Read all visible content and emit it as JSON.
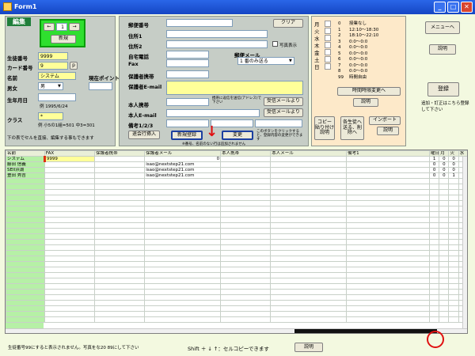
{
  "window": {
    "title": "Form1",
    "minimize": "_",
    "maximize": "□",
    "close": "✕"
  },
  "edit": {
    "badge": "編集",
    "prev": "←",
    "page": "1",
    "next": "→",
    "new_label": "新規"
  },
  "left_form": {
    "student_no_label": "生徒番号",
    "student_no": "9999",
    "card_no_label": "カード番号",
    "card_no": "9",
    "p_button": "p",
    "name_label": "名前",
    "name": "システム",
    "gender_label": "男女",
    "gender": "男",
    "points_label": "現在ポイント",
    "points": "",
    "birthday_label": "生年月日",
    "birthday": "",
    "birthday_hint": "例 1995/6/24",
    "class_label": "クラス",
    "class_value": "*",
    "class_hint": "例 小5の1組=501 中3=301",
    "table_note": "下の表でセルを直接、編集する事もできます"
  },
  "middle_form": {
    "postal_label": "郵便番号",
    "clear_button": "クリア",
    "addr1_label": "住所1",
    "addr2_label": "住所2",
    "photo_label": "写真表示",
    "home_tel_label": "自宅電話",
    "mail_dest_label": "郵便メール",
    "fax_label": "Fax",
    "mail_dest_value": "1 番のみ送る",
    "guardian_mobile_label": "保護者携帯",
    "guardian_email_label": "保護者E-mail",
    "mobile_label": "本人携帯",
    "mobile_note": "携帯に返信を送信(アドレス)で下さい",
    "receive_mail_button_1": "受信メールより",
    "email_label": "本人E-mail",
    "receive_mail_button_2": "受信メールより",
    "remarks_label": "備考1/2/3",
    "enroll_button": "退会行挿入",
    "new_register_button": "新規登録",
    "change_button": "変更",
    "change_note": "このボタンをクリックすると、登録内容の変更ができます",
    "caution": "※番号、名前のない行は追加されません"
  },
  "schedule": {
    "days": [
      "月",
      "火",
      "水",
      "木",
      "金",
      "土",
      "日"
    ],
    "slot_numbers": [
      "0",
      "1",
      "2",
      "3",
      "4",
      "5",
      "6",
      "7",
      "8",
      "99"
    ],
    "slot_labels": [
      "授業なし",
      "12:10～18:30",
      "18:10～22:10",
      "0:0～0:0",
      "0:0～0:0",
      "0:0～0:0",
      "0:0～0:0",
      "0:0～0:0",
      "0:0～0:0",
      "時間自由"
    ],
    "time_change_button": "時間時限変更へ",
    "explain_button": "説明",
    "copy_button": "コピー 貼り付け 説明",
    "each_student_button": "各生徒へ 送る、削除へ",
    "import_button": "インポート",
    "import_explain_button": "説明"
  },
  "right": {
    "menu_button": "メニューへ",
    "explain_button": "説明",
    "register_button": "登録",
    "register_note": "追加・訂正はこちら登録して下さい"
  },
  "table": {
    "columns": [
      "名前",
      "FAX",
      "保護者携帯",
      "保護者メール",
      "本人携帯",
      "本人メール",
      "備考1",
      "曜日",
      "月",
      "火",
      "水"
    ],
    "rows": [
      {
        "name": "システム",
        "fax": "9999",
        "guardian_mobile": "",
        "guardian_email": "",
        "num": "0",
        "mobile": "",
        "email": "",
        "memo": "",
        "w": "1",
        "mon": "0",
        "tue": "0",
        "wed": "2"
      },
      {
        "name": "藤田 信義",
        "fax": "",
        "guardian_mobile": "",
        "guardian_email": "isao@nextstep21.com",
        "num": "",
        "mobile": "",
        "email": "",
        "memo": "",
        "w": "0",
        "mon": "0",
        "tue": "0",
        "wed": "2"
      },
      {
        "name": "SEII浜湖",
        "fax": "",
        "guardian_mobile": "",
        "guardian_email": "isao@nextstep21.com",
        "num": "",
        "mobile": "",
        "email": "",
        "memo": "",
        "w": "0",
        "mon": "0",
        "tue": "0",
        "wed": "2"
      },
      {
        "name": "豊田 秀吉",
        "fax": "",
        "guardian_mobile": "",
        "guardian_email": "isao@nextstep21.com",
        "num": "",
        "mobile": "",
        "email": "",
        "memo": "",
        "w": "0",
        "mon": "0",
        "tue": "1",
        "wed": "0"
      }
    ]
  },
  "status": {
    "left_msg": "生徒番号99にすると表示されません。写真をな20 89にして下さい",
    "shift_msg": "Shift ＋ ↓ ↑：セルコピーできます",
    "explain_button": "説明"
  }
}
